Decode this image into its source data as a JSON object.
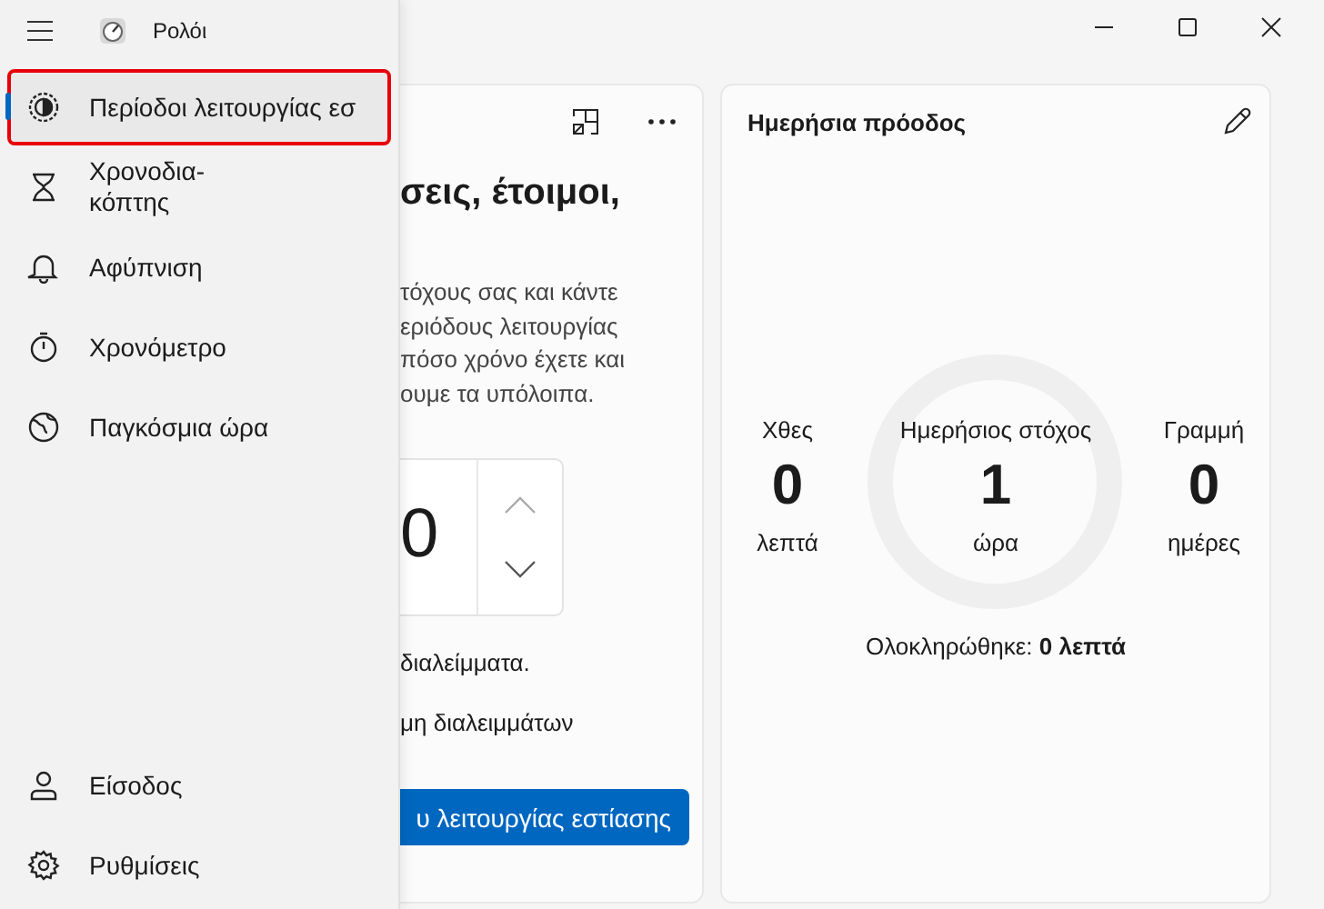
{
  "window": {
    "title": "Ρολόι"
  },
  "sidebar": {
    "items": [
      {
        "kind": "focus",
        "label": "Περίοδοι λειτουργίας εσ",
        "selected": true,
        "highlighted": true
      },
      {
        "kind": "timer",
        "label": "Χρονοδια-\nκόπτης",
        "selected": false,
        "highlighted": false
      },
      {
        "kind": "alarm",
        "label": "Αφύπνιση",
        "selected": false,
        "highlighted": false
      },
      {
        "kind": "stopwatch",
        "label": "Χρονόμετρο",
        "selected": false,
        "highlighted": false
      },
      {
        "kind": "world",
        "label": "Παγκόσμια ώρα",
        "selected": false,
        "highlighted": false
      }
    ],
    "footer_items": [
      {
        "kind": "account",
        "label": "Είσοδος",
        "selected": false
      },
      {
        "kind": "settings",
        "label": "Ρυθμίσεις",
        "selected": false
      }
    ]
  },
  "focus_card": {
    "heading": "σεις, έτοιμοι,",
    "description": [
      "τόχους σας και κάντε",
      "εριόδους λειτουργίας",
      "πόσο χρόνο έχετε και",
      "ουμε τα υπόλοιπα."
    ],
    "spinner": {
      "value": "0"
    },
    "break_text": "διαλείμματα.",
    "skip_text": "μη διαλειμμάτων",
    "start_button": "υ λειτουργίας εστίασης"
  },
  "progress_card": {
    "title": "Ημερήσια πρόοδος",
    "stats": [
      {
        "label": "Χθες",
        "value": "0",
        "unit": "λεπτά"
      },
      {
        "label": "Ημερήσιος στόχος",
        "value": "1",
        "unit": "ώρα"
      },
      {
        "label": "Γραμμή",
        "value": "0",
        "unit": "ημέρες"
      }
    ],
    "completed": "Ολοκληρώθηκε: **0 λεπτά**"
  }
}
